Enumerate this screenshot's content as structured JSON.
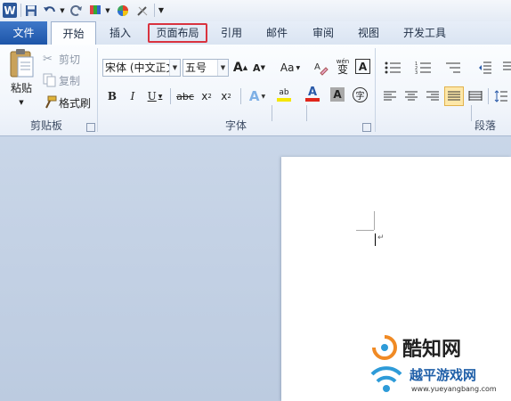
{
  "tabs": {
    "file": "文件",
    "home": "开始",
    "insert": "插入",
    "page_layout": "页面布局",
    "references": "引用",
    "mailings": "邮件",
    "review": "审阅",
    "view": "视图",
    "developer": "开发工具"
  },
  "clipboard": {
    "paste": "粘贴",
    "cut": "剪切",
    "copy": "复制",
    "format_painter": "格式刷",
    "group_label": "剪贴板"
  },
  "font": {
    "font_name": "宋体 (中文正文",
    "font_size": "五号",
    "grow": "A",
    "shrink": "A",
    "change_case": "Aa",
    "phonetic": "wén",
    "phonetic_char": "变",
    "border_char": "A",
    "bold": "B",
    "italic": "I",
    "underline": "U",
    "strike": "abc",
    "subscript": "x",
    "superscript": "x",
    "text_effects": "A",
    "highlight": "ab",
    "font_color": "A",
    "char_shading": "A",
    "enclose": "字",
    "group_label": "字体",
    "font_color_value": "#e0261b",
    "highlight_color_value": "#f5e600"
  },
  "paragraph": {
    "group_label": "段落"
  },
  "watermark": {
    "brand1": "酷知网",
    "brand2": "越平游戏网",
    "brand2_url": "www.yueyangbang.com"
  },
  "colors": {
    "accent": "#2b579a",
    "highlight_border": "#d9333f"
  }
}
